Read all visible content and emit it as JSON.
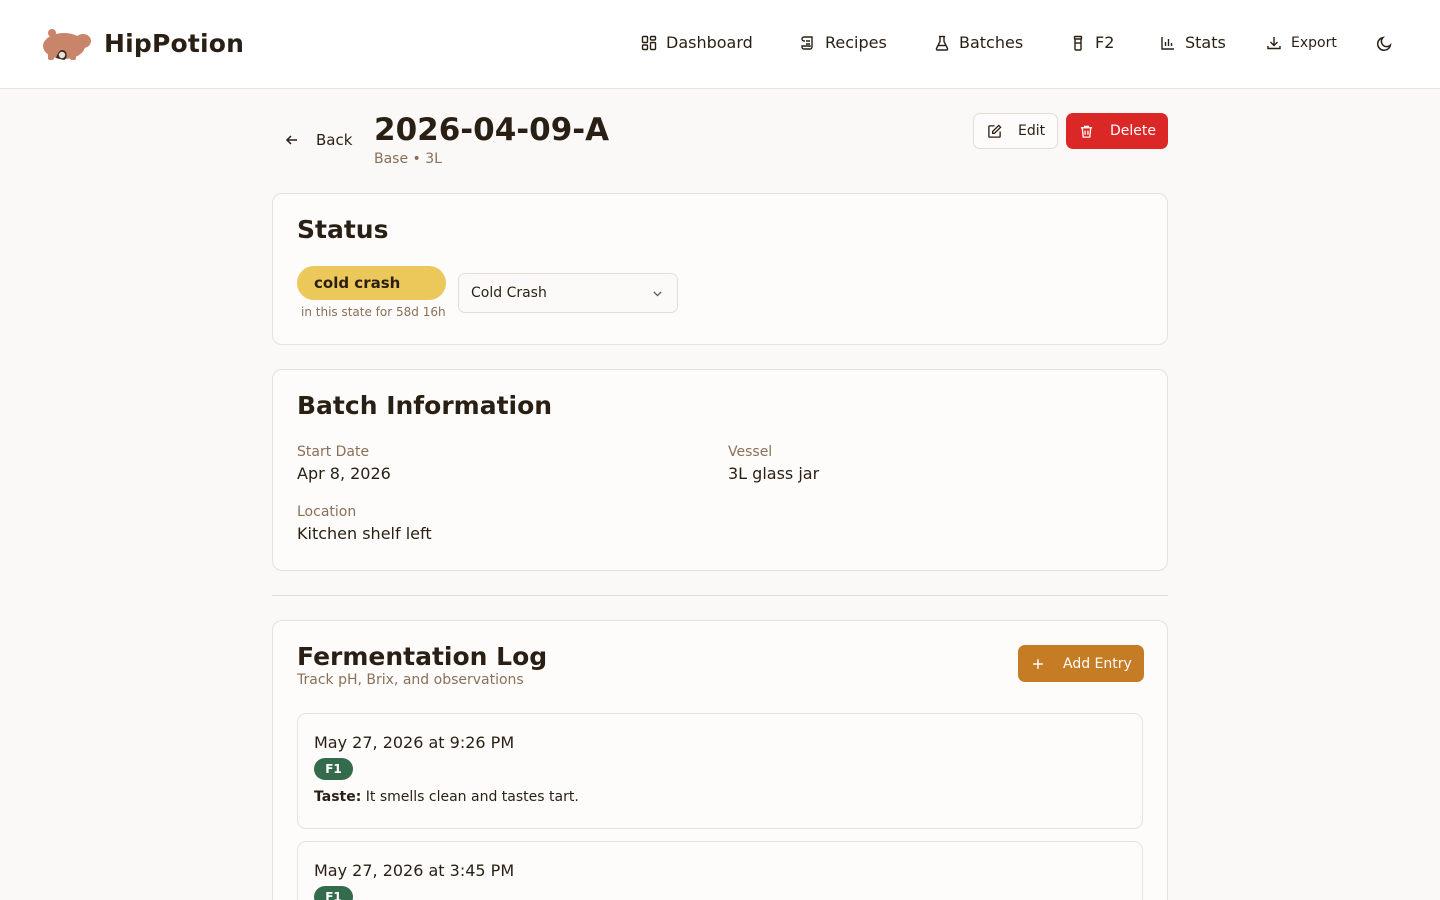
{
  "app": {
    "name": "HipPotion",
    "logo_icon": "hippo-logo-icon",
    "brand_color": "#c8856a"
  },
  "nav": {
    "items": [
      {
        "label": "Dashboard",
        "icon": "dashboard-grid-icon"
      },
      {
        "label": "Recipes",
        "icon": "scroll-icon"
      },
      {
        "label": "Batches",
        "icon": "flask-icon"
      },
      {
        "label": "F2",
        "icon": "bottle-icon"
      },
      {
        "label": "Stats",
        "icon": "bar-chart-icon"
      },
      {
        "label": "Export",
        "icon": "download-icon"
      }
    ],
    "theme_toggle_icon": "moon-icon"
  },
  "page": {
    "back_label": "Back",
    "title": "2026-04-09-A",
    "subtitle": "Base • 3L",
    "edit_label": "Edit",
    "delete_label": "Delete",
    "delete_color": "#dc2727"
  },
  "status": {
    "title": "Status",
    "current": "cold crash",
    "current_color": "#ecc85a",
    "duration": "in this state for 58d 16h",
    "select_value": "Cold Crash"
  },
  "batch_info": {
    "title": "Batch Information",
    "fields": [
      {
        "label": "Start Date",
        "value": "Apr 8, 2026"
      },
      {
        "label": "Vessel",
        "value": "3L glass jar"
      },
      {
        "label": "Location",
        "value": "Kitchen shelf left"
      }
    ]
  },
  "log": {
    "title": "Fermentation Log",
    "subtitle": "Track pH, Brix, and observations",
    "add_label": "Add Entry",
    "add_color": "#c67c25",
    "entries": [
      {
        "date": "May 27, 2026 at 9:26 PM",
        "badge": "F1",
        "note_label": "Taste:",
        "note_text": "It smells clean and tastes tart."
      },
      {
        "date": "May 27, 2026 at 3:45 PM",
        "badge": "F1"
      }
    ]
  }
}
